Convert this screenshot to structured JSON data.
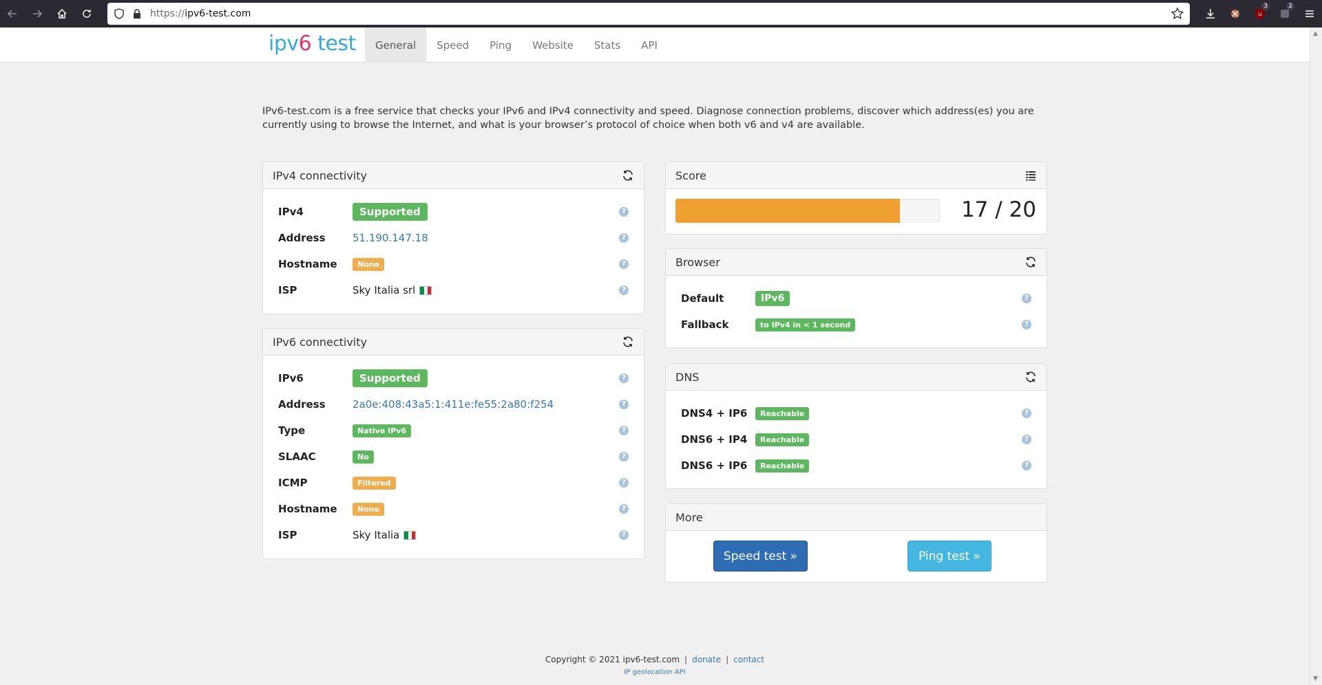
{
  "browser": {
    "url_protocol": "https://",
    "url_host": "ipv6-test.com",
    "extension_badge_1": "3",
    "extension_badge_2": "2"
  },
  "site": {
    "brand_part1": "ipv",
    "brand_part2": "6",
    "brand_part3": " test",
    "nav": [
      "General",
      "Speed",
      "Ping",
      "Website",
      "Stats",
      "API"
    ],
    "nav_active": "General"
  },
  "intro": "IPv6-test.com is a free service that checks your IPv6 and IPv4 connectivity and speed. Diagnose connection problems, discover which address(es) you are currently using to browse the Internet, and what is your browser’s protocol of choice when both v6 and v4 are available.",
  "ipv4": {
    "title": "IPv4 connectivity",
    "rows": [
      {
        "label": "IPv4",
        "value": "Supported"
      },
      {
        "label": "Address",
        "value": "51.190.147.18"
      },
      {
        "label": "Hostname",
        "value": "None"
      },
      {
        "label": "ISP",
        "value": "Sky Italia srl"
      }
    ]
  },
  "ipv6": {
    "title": "IPv6 connectivity",
    "rows": [
      {
        "label": "IPv6",
        "value": "Supported"
      },
      {
        "label": "Address",
        "value": "2a0e:408:43a5:1:411e:fe55:2a80:f254"
      },
      {
        "label": "Type",
        "value": "Native IPv6"
      },
      {
        "label": "SLAAC",
        "value": "No"
      },
      {
        "label": "ICMP",
        "value": "Filtered"
      },
      {
        "label": "Hostname",
        "value": "None"
      },
      {
        "label": "ISP",
        "value": "Sky Italia"
      }
    ]
  },
  "score": {
    "title": "Score",
    "value_text": "17 / 20",
    "fraction": 0.85
  },
  "browser_panel": {
    "title": "Browser",
    "rows": [
      {
        "label": "Default",
        "value": "IPv6"
      },
      {
        "label": "Fallback",
        "value": "to IPv4 in < 1 second"
      }
    ]
  },
  "dns": {
    "title": "DNS",
    "rows": [
      {
        "label": "DNS4 + IP6",
        "value": "Reachable"
      },
      {
        "label": "DNS6 + IP4",
        "value": "Reachable"
      },
      {
        "label": "DNS6 + IP6",
        "value": "Reachable"
      }
    ]
  },
  "more": {
    "title": "More",
    "speed_button": "Speed test »",
    "ping_button": "Ping test »"
  },
  "footer": {
    "copyright": "Copyright © 2021 ipv6-test.com",
    "donate": "donate",
    "contact": "contact",
    "geo": "IP geolocation API"
  },
  "colors": {
    "green": "#5cb85c",
    "orange": "#f0ad4e",
    "link": "#337ab7",
    "score_fill": "#f0a030"
  },
  "help_glyph": "?",
  "flag_country": "Italy"
}
